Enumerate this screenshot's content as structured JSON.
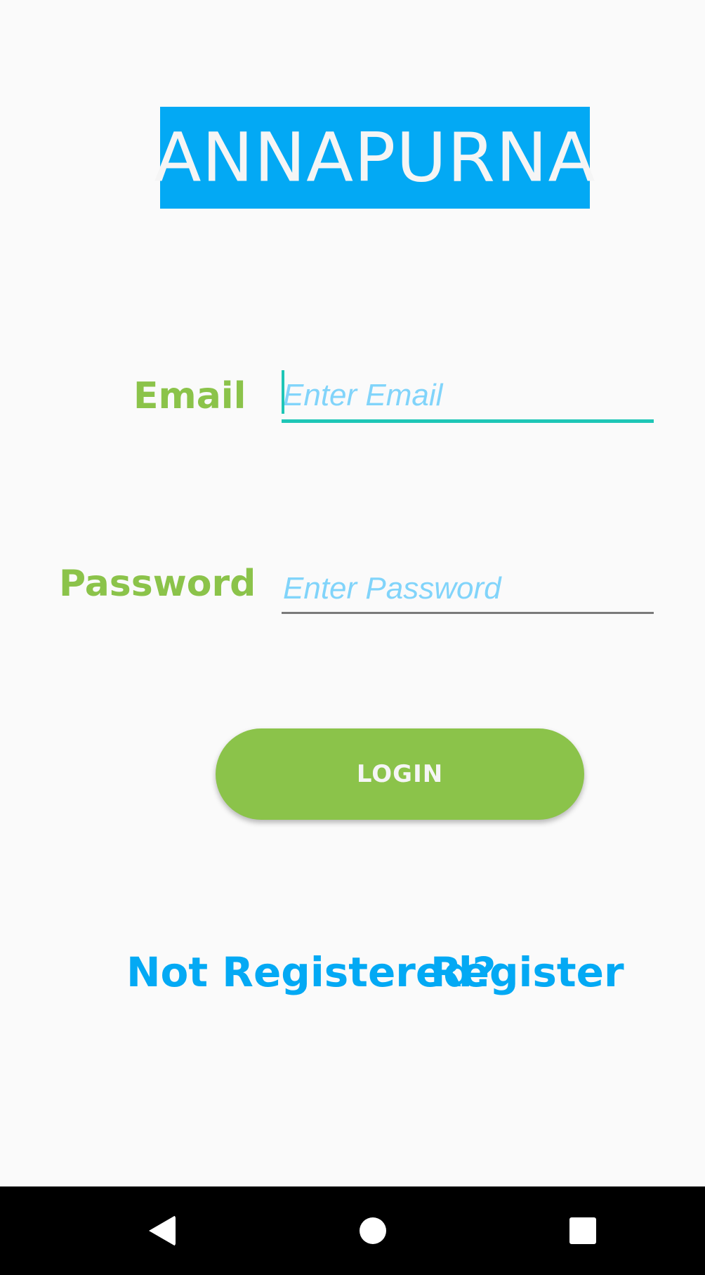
{
  "app": {
    "title": "ANNAPURNA"
  },
  "form": {
    "email": {
      "label": "Email",
      "placeholder": "Enter Email",
      "value": ""
    },
    "password": {
      "label": "Password",
      "placeholder": "Enter Password",
      "value": ""
    },
    "login_label": "LOGIN"
  },
  "footer": {
    "not_registered_text": "Not Registered?",
    "register_link": "Register"
  },
  "nav_bar": {
    "back_icon": "back-triangle-icon",
    "home_icon": "home-circle-icon",
    "recents_icon": "recents-square-icon"
  },
  "colors": {
    "banner": "#03a9f4",
    "label_green": "#8bc34a",
    "focus_accent": "#1ec6b6",
    "link_blue": "#03a9f4",
    "placeholder": "#81d4fa"
  }
}
